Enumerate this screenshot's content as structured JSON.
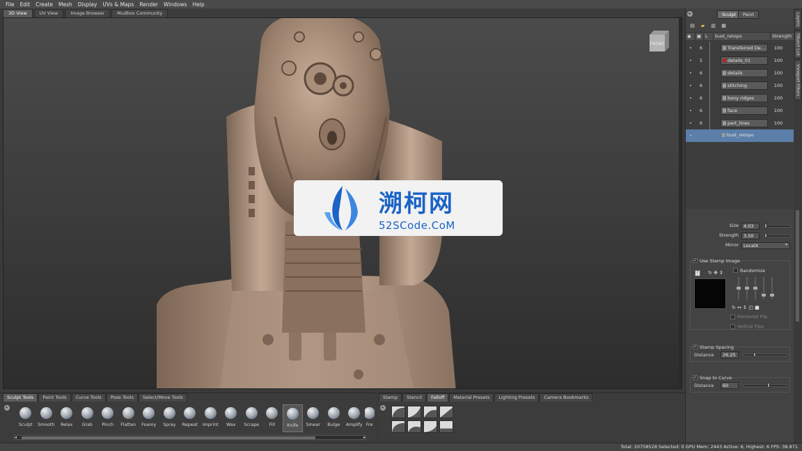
{
  "menu": [
    "File",
    "Edit",
    "Create",
    "Mesh",
    "Display",
    "UVs & Maps",
    "Render",
    "Windows",
    "Help"
  ],
  "view_tabs": [
    "3D View",
    "UV View",
    "Image Browser",
    "Mudbox Community"
  ],
  "view_tabs_active": 0,
  "viewcube_label": "FRONT",
  "watermark": {
    "title": "溯柯网",
    "subtitle": "52SCode.CoM",
    "color": "#1b63c7"
  },
  "right_panel": {
    "mode_tabs": [
      "Sculpt",
      "Paint"
    ],
    "side_tabs": [
      "Layers",
      "Object List",
      "Viewport Filters"
    ],
    "toolbar_icons": [
      "new-layer-icon",
      "folder-icon",
      "delete-layer-icon",
      "merge-layer-icon"
    ],
    "layer_header": {
      "col_l": "L",
      "col_name": "bust_retopo",
      "col_strength": "Strength"
    },
    "layers": [
      {
        "level": "6",
        "name": "Transferred De...",
        "strength": "100"
      },
      {
        "level": "5",
        "name": "details_01",
        "strength": "100"
      },
      {
        "level": "6",
        "name": "details",
        "strength": "100"
      },
      {
        "level": "6",
        "name": "stitching",
        "strength": "100"
      },
      {
        "level": "6",
        "name": "bony ridges",
        "strength": "100"
      },
      {
        "level": "6",
        "name": "face",
        "strength": "100"
      },
      {
        "level": "6",
        "name": "part_lines",
        "strength": "100"
      }
    ],
    "base_layer": "bust_retopo",
    "size_label": "Size",
    "size_value": "4.03",
    "strength_label": "Strength",
    "strength_value": "3.50",
    "mirror_label": "Mirror",
    "mirror_value": "LocalX",
    "use_stamp_label": "Use Stamp Image",
    "randomize_label": "Randomize",
    "horizontal_flip_label": "Horizontal Flip",
    "vertical_flip_label": "Vertical Flips",
    "stamp_spacing_label": "Stamp Spacing",
    "distance_label": "Distance",
    "distance_value": "26.25",
    "snap_label": "Snap to Curve",
    "snap_distance_label": "Distance",
    "snap_distance_value": "60"
  },
  "bottom_left": {
    "tabs": [
      "Sculpt Tools",
      "Paint Tools",
      "Curve Tools",
      "Pose Tools",
      "Select/Move Tools"
    ],
    "tools": [
      "Sculpt",
      "Smooth",
      "Relax",
      "Grab",
      "Pinch",
      "Flatten",
      "Foamy",
      "Spray",
      "Repeat",
      "Imprint",
      "Wax",
      "Scrape",
      "Fill",
      "Knife",
      "Smear",
      "Bulge",
      "Amplify",
      "Fre"
    ],
    "active_tool": "Knife"
  },
  "bottom_right": {
    "tabs": [
      "Stamp",
      "Stencil",
      "Falloff",
      "Material Presets",
      "Lighting Presets",
      "Camera Bookmarks"
    ],
    "active_tab": "Falloff"
  },
  "status": "Total: 20758528  Selected: 0 GPU Mem: 2443  Active: 6, Highest: 6  FPS: 38.871"
}
